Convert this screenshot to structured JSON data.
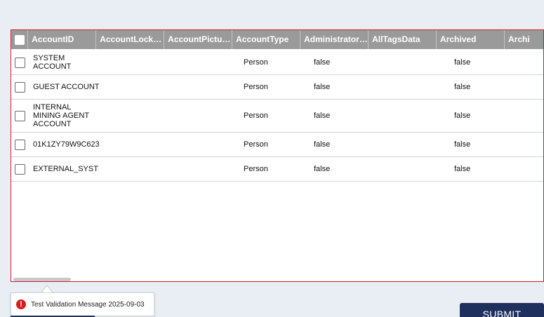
{
  "grid": {
    "columns": [
      "AccountID",
      "AccountLocke…",
      "AccountPictur…",
      "AccountType",
      "Administrator…",
      "AllTagsData",
      "Archived",
      "Archi"
    ],
    "rows": [
      {
        "account_id": "SYSTEM ACCOUNT",
        "account_type": "Person",
        "administrator": "false",
        "archived": "false"
      },
      {
        "account_id": "GUEST ACCOUNT",
        "account_type": "Person",
        "administrator": "false",
        "archived": "false"
      },
      {
        "account_id": "INTERNAL MINING AGENT ACCOUNT",
        "account_type": "Person",
        "administrator": "false",
        "archived": "false"
      },
      {
        "account_id": "01K1ZY79W9C623",
        "account_type": "Person",
        "administrator": "false",
        "archived": "false"
      },
      {
        "account_id": "EXTERNAL_SYSTI",
        "account_type": "Person",
        "administrator": "false",
        "archived": "false"
      }
    ]
  },
  "validation": {
    "icon": "error-icon",
    "icon_glyph": "!",
    "message": "Test Validation Message 2025-09-03"
  },
  "actions": {
    "submit_label": "SUBMIT"
  },
  "colors": {
    "header_bg": "#9a9a9a",
    "grid_border": "#d0202a",
    "submit_bg": "#1f2f5e",
    "error": "#d91d1d",
    "page_bg": "#e9edf4"
  }
}
